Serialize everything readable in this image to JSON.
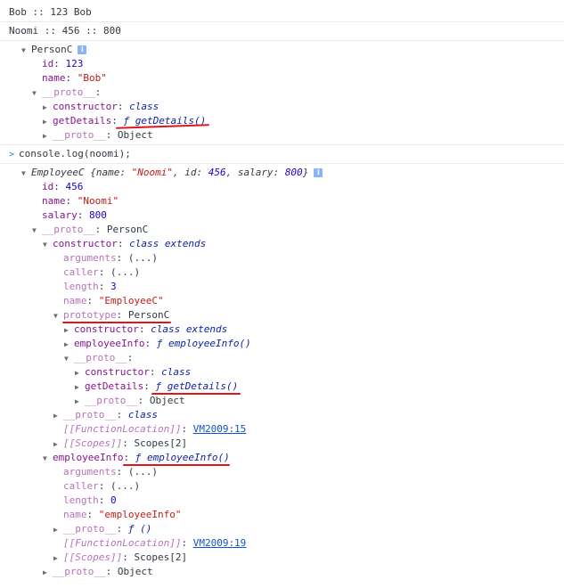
{
  "log_lines": {
    "bob": "Bob :: 123 Bob",
    "noomi": "Noomi :: 456 :: 800"
  },
  "person": {
    "class_name": "PersonC",
    "id_key": "id",
    "id_val": "123",
    "name_key": "name",
    "name_val": "\"Bob\"",
    "proto_key": "__proto__",
    "constructor_key": "constructor",
    "constructor_val": "class",
    "getdetails_key": "getDetails",
    "getdetails_f": "ƒ",
    "getdetails_val": "getDetails()",
    "proto2_key": "__proto__",
    "proto2_val": "Object"
  },
  "command": {
    "text": "console.log(noomi);"
  },
  "employee": {
    "header_class": "EmployeeC",
    "header_preview": "{name: ",
    "hp_name_val": "\"Noomi\"",
    "hp_id": ", id: ",
    "hp_id_val": "456",
    "hp_salary": ", salary: ",
    "hp_salary_val": "800",
    "hp_close": "}",
    "id_key": "id",
    "id_val": "456",
    "name_key": "name",
    "name_val": "\"Noomi\"",
    "salary_key": "salary",
    "salary_val": "800",
    "proto_key": "__proto__",
    "proto_val": "PersonC",
    "ctor_key": "constructor",
    "ctor_val": "class extends",
    "args_key": "arguments",
    "args_val": "(...)",
    "caller_key": "caller",
    "caller_val": "(...)",
    "length_key": "length",
    "length_val": "3",
    "cname_key": "name",
    "cname_val": "\"EmployeeC\"",
    "prototype_key": "prototype",
    "prototype_val": "PersonC",
    "pctor_key": "constructor",
    "pctor_val": "class extends",
    "pinfo_key": "employeeInfo",
    "pinfo_f": "ƒ",
    "pinfo_val": "employeeInfo()",
    "pproto_key": "__proto__",
    "ppctor_key": "constructor",
    "ppctor_val": "class",
    "ppget_key": "getDetails",
    "ppget_f": "ƒ",
    "ppget_val": "getDetails()",
    "ppproto_key": "__proto__",
    "ppproto_val": "Object",
    "cproto_key": "__proto__",
    "cproto_val": "class",
    "floc_key": "[[FunctionLocation]]",
    "floc_val": "VM2009:15",
    "scopes_key": "[[Scopes]]",
    "scopes_val": "Scopes[2]",
    "info_key": "employeeInfo",
    "info_f": "ƒ",
    "info_val": "employeeInfo()",
    "iargs_key": "arguments",
    "iargs_val": "(...)",
    "icaller_key": "caller",
    "icaller_val": "(...)",
    "ilength_key": "length",
    "ilength_val": "0",
    "iname_key": "name",
    "iname_val": "\"employeeInfo\"",
    "iproto_key": "__proto__",
    "iproto_val": "ƒ ()",
    "ifloc_key": "[[FunctionLocation]]",
    "ifloc_val": "VM2009:19",
    "iscopes_key": "[[Scopes]]",
    "iscopes_val": "Scopes[2]",
    "lproto_key": "__proto__",
    "lproto_val": "Object"
  },
  "colors": {
    "annotation_underline": "#e01717",
    "info_badge": "#8ab4f8"
  }
}
